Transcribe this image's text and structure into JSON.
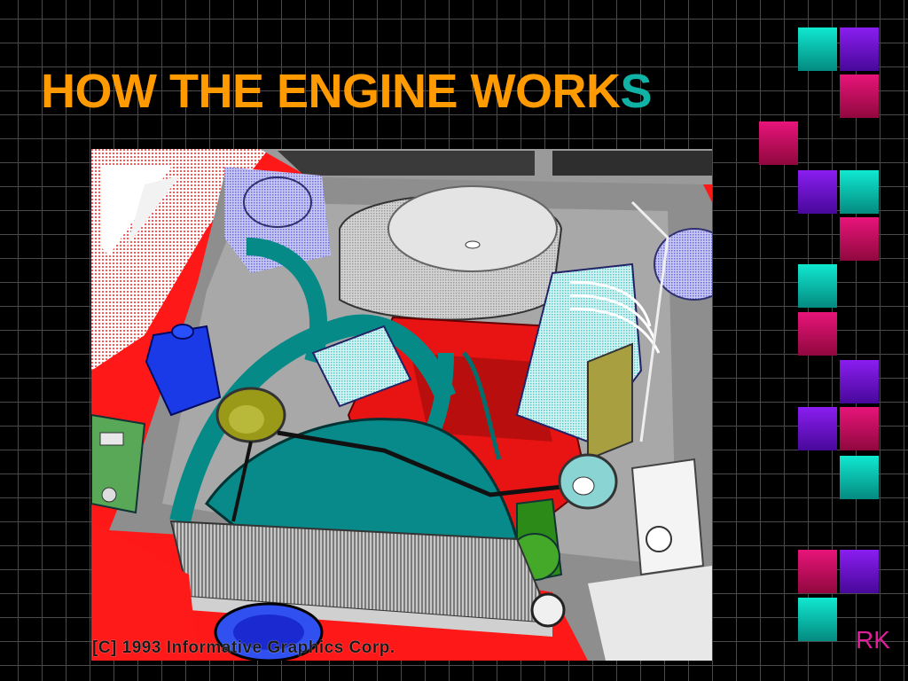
{
  "slide": {
    "title_main": "HOW THE ENGINE WORK",
    "title_last_letter": "S",
    "copyright": "[C] 1993 Informative Graphics Corp.",
    "initials": "RK"
  },
  "colors": {
    "title": "#ff9a00",
    "title_accent": "#10b2a6",
    "background": "#000000",
    "grid": "#4a4a4a",
    "tile_teal": "#10e8d0",
    "tile_purple": "#8a1ef0",
    "tile_magenta": "#e8147a",
    "initials": "#e01d9a"
  },
  "illustration": {
    "subject": "car engine compartment clipart"
  }
}
